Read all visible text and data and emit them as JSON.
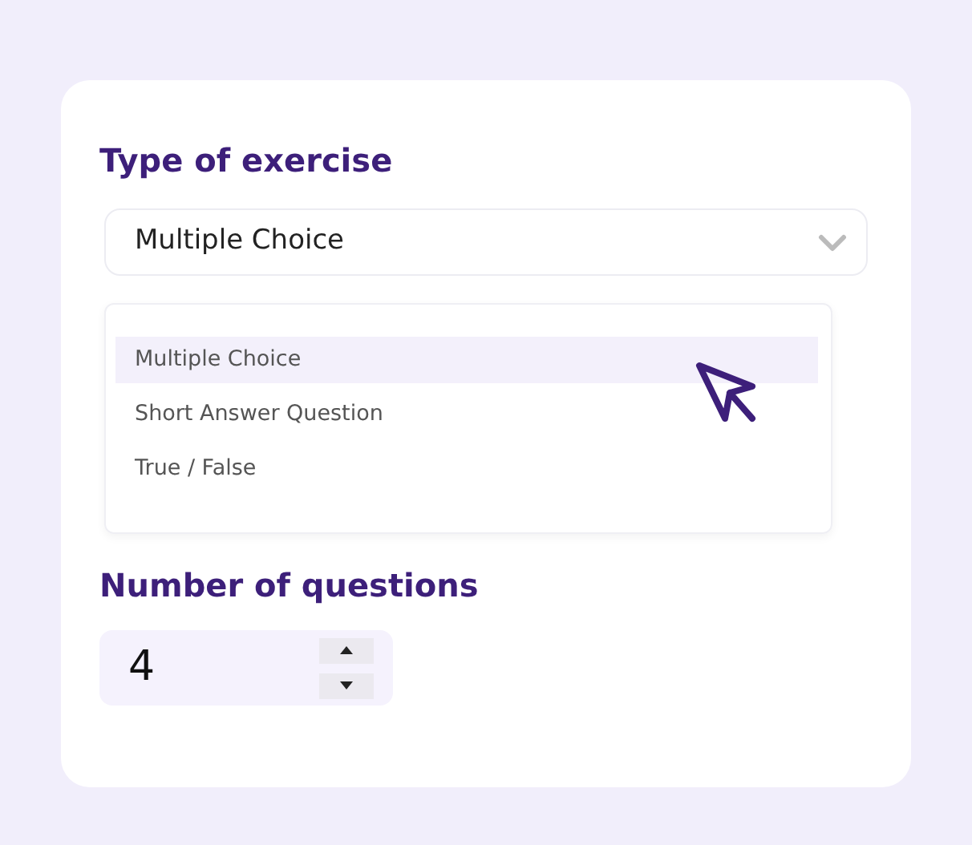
{
  "exercise_type": {
    "heading": "Type of exercise",
    "value": "Multiple Choice",
    "expanded": true,
    "options": [
      {
        "label": "Multiple Choice",
        "selected": true
      },
      {
        "label": "Short Answer Question",
        "selected": false
      },
      {
        "label": "True / False",
        "selected": false
      }
    ]
  },
  "questions": {
    "heading": "Number of questions",
    "value": "4"
  }
}
